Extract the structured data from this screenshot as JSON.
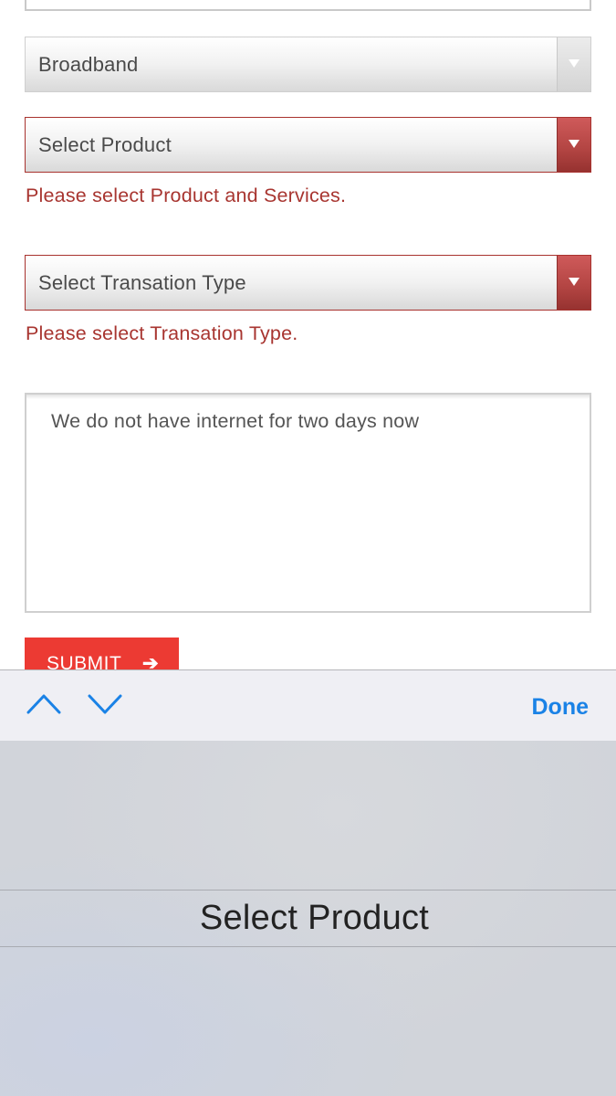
{
  "form": {
    "category_select": {
      "value": "Broadband"
    },
    "product_select": {
      "value": "Select Product",
      "error": "Please select Product and Services."
    },
    "transaction_select": {
      "value": "Select Transation Type",
      "error": "Please select Transation Type."
    },
    "message_textarea": {
      "value": "We do not have internet for two days now"
    },
    "submit_button": {
      "label": "SUBMIT",
      "arrow": "➔"
    }
  },
  "keyboard_toolbar": {
    "done_label": "Done",
    "icons": [
      "chevron-up-icon",
      "chevron-down-icon"
    ],
    "accent_color": "#1a82e6"
  },
  "picker": {
    "selected_option": "Select Product"
  },
  "colors": {
    "error": "#a83530",
    "submit": "#ec3a33"
  }
}
